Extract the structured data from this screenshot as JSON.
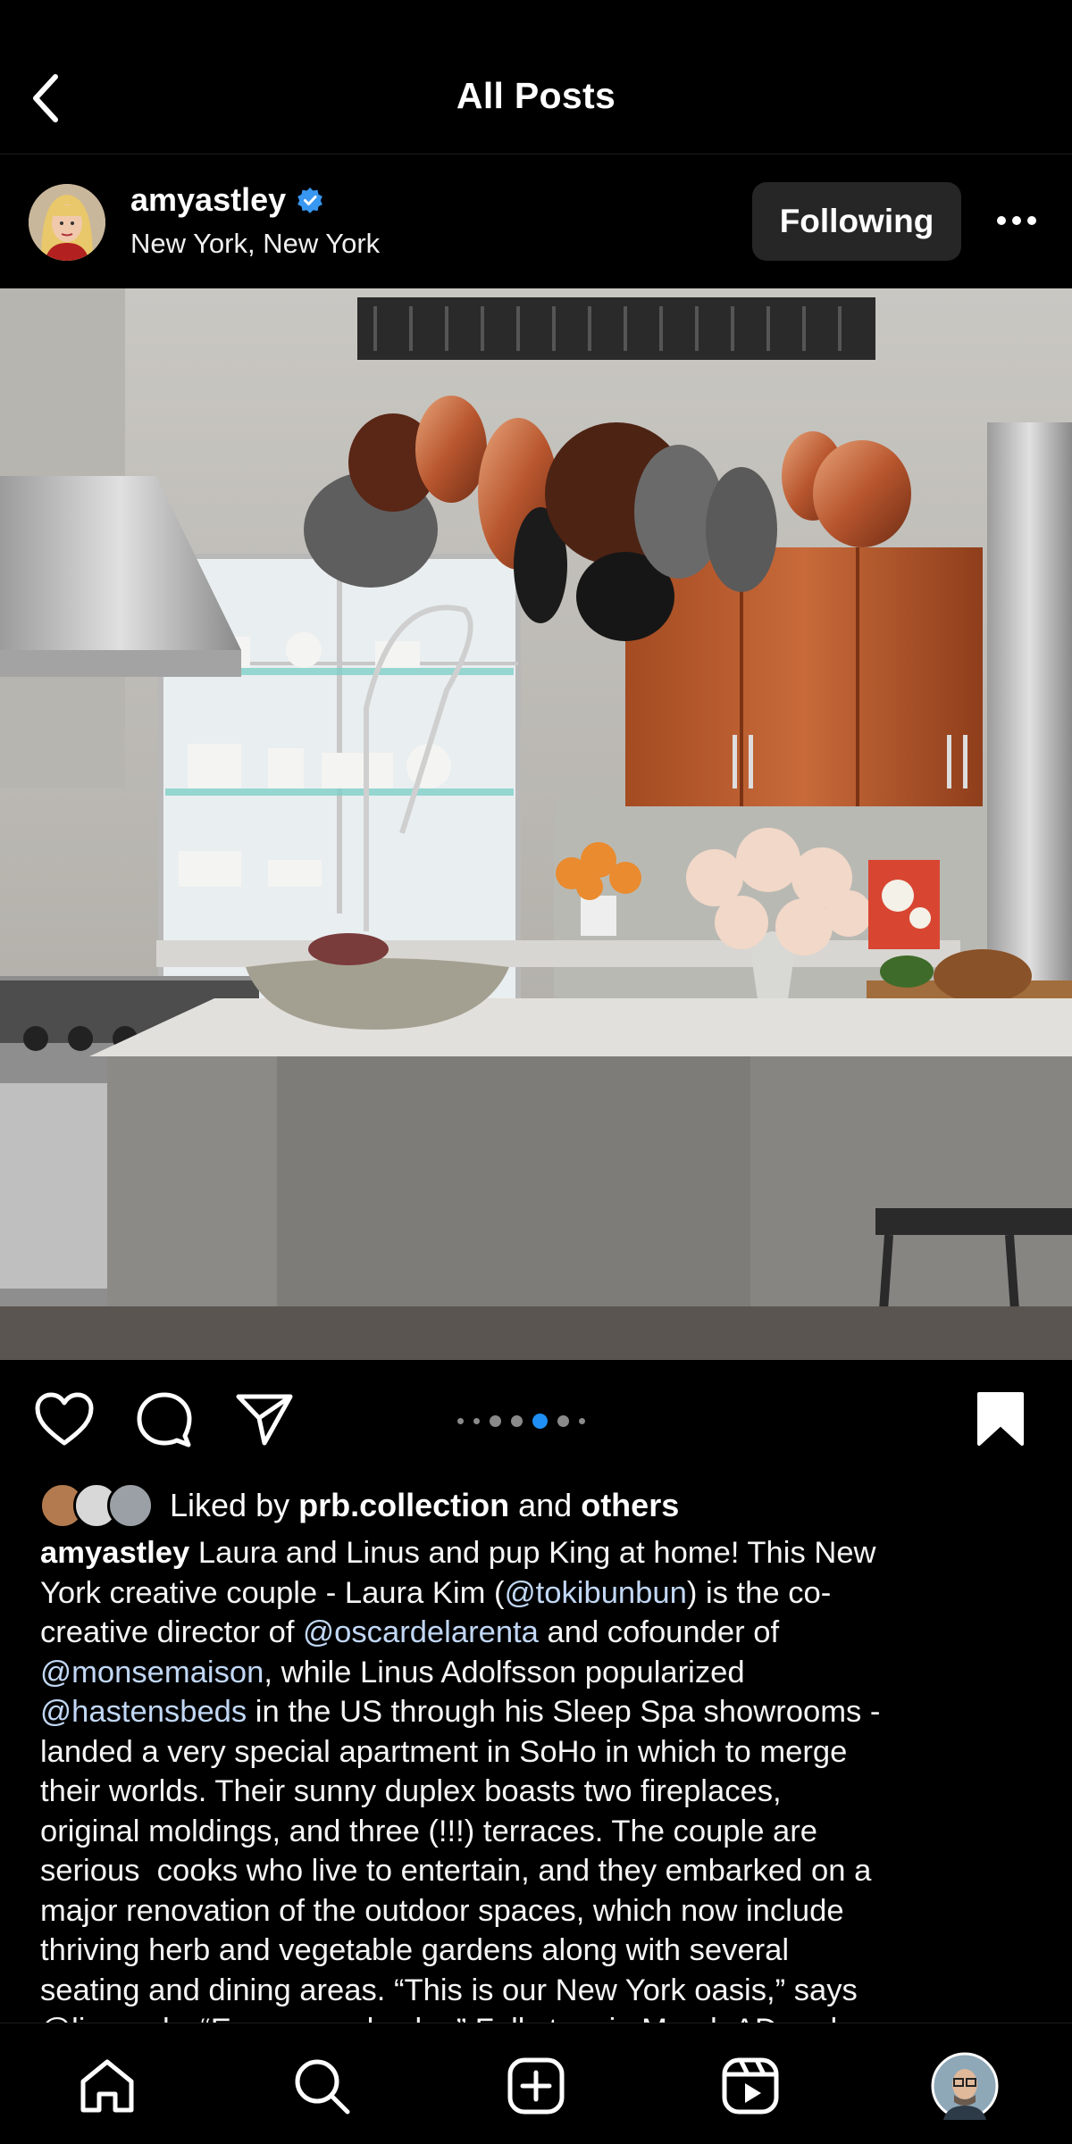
{
  "header": {
    "title": "All Posts",
    "back_icon": "chevron-left-icon"
  },
  "post": {
    "username": "amyastley",
    "verified": true,
    "location": "New York, New York",
    "follow_label": "Following",
    "more_icon": "ellipsis-icon",
    "image_alt": "Kitchen with hanging copper pot rack, marble island and flowers"
  },
  "carousel": {
    "count": 7,
    "active_index": 4
  },
  "actions": [
    "heart-icon",
    "comment-icon",
    "share-icon",
    "bookmark-icon"
  ],
  "likes": {
    "prefix": "Liked by ",
    "user": "prb.collection",
    "middle": " and ",
    "others": "others"
  },
  "caption": {
    "author": "amyastley",
    "lines": [
      [
        {
          "t": " Laura and Linus and pup King at home! This New"
        }
      ],
      [
        {
          "t": "York creative couple - Laura Kim ("
        },
        {
          "t": "@tokibunbun",
          "m": true
        },
        {
          "t": ") is the co-"
        }
      ],
      [
        {
          "t": "creative director of "
        },
        {
          "t": "@oscardelarenta",
          "m": true
        },
        {
          "t": " and cofounder of"
        }
      ],
      [
        {
          "t": "@monsemaison",
          "m": true
        },
        {
          "t": ", while Linus Adolfsson popularized"
        }
      ],
      [
        {
          "t": "@hastensbeds",
          "m": true
        },
        {
          "t": " in the US through his Sleep Spa showrooms -"
        }
      ],
      [
        {
          "t": "landed a very special apartment in SoHo in which to merge"
        }
      ],
      [
        {
          "t": "their worlds. Their sunny duplex boasts two fireplaces,"
        }
      ],
      [
        {
          "t": "original moldings, and three (!!!) terraces. The couple are"
        }
      ],
      [
        {
          "t": "serious  cooks who live to entertain, and they embarked on a"
        }
      ],
      [
        {
          "t": "major renovation of the outdoor spaces, which now include"
        }
      ],
      [
        {
          "t": "thriving herb and vegetable gardens along with several"
        }
      ],
      [
        {
          "t": "seating and dining areas. “This is our New York oasis,” says"
        }
      ],
      [
        {
          "t": "@linusadw “Escape and calm,” Full story in March AD and",
          "m": false
        }
      ]
    ]
  },
  "bottom_nav": [
    "home-icon",
    "search-icon",
    "create-icon",
    "reels-icon",
    "profile-avatar"
  ]
}
